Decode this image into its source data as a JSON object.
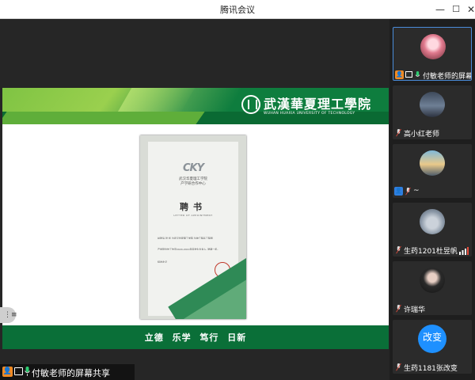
{
  "window": {
    "title": "腾讯会议",
    "min": "—",
    "max": "☐",
    "close": "✕"
  },
  "slide": {
    "university_cn": "武漢華夏理工學院",
    "university_en": "WUHAN HUAXIA UNIVERSITY OF TECHNOLOGY",
    "motto": "立德 乐学 笃行 日新",
    "certificate": {
      "logo": "CKY",
      "org_line1": "武汉华夏理工学院",
      "org_line2": "产学研合作中心",
      "title": "聘书",
      "title_en": "LETTER OF APPOINTMENT",
      "body_line1": "兹聘请 张 凯 为武汉华夏理工学院 生物工程系工程师",
      "body_line2": "产学研合作工作室2020-2021年度学生负责人, 聘期一年。",
      "body_line3": "特发此证"
    }
  },
  "more_button": {
    "icon": "list-icon",
    "glyph": "⋮≡"
  },
  "share_label": {
    "text": "付敏老师的屏幕共享"
  },
  "participants": [
    {
      "name": "付敏老师的屏幕...",
      "active": true,
      "badge": "host"
    },
    {
      "name": "高小红老师",
      "active": false,
      "badge": "none"
    },
    {
      "name": "~",
      "active": false,
      "badge": "blue"
    },
    {
      "name": "生药1201杜昱帆",
      "active": false,
      "badge": "none"
    },
    {
      "name": "许瑞华",
      "active": false,
      "badge": "none"
    },
    {
      "name": "生药1181张改变",
      "active": false,
      "badge": "none",
      "avatar_text": "改变"
    }
  ],
  "colors": {
    "accent": "#0e7d3e",
    "light_green": "#7cc242",
    "host_orange": "#f08a24",
    "avatar_blue": "#1e90ff"
  }
}
